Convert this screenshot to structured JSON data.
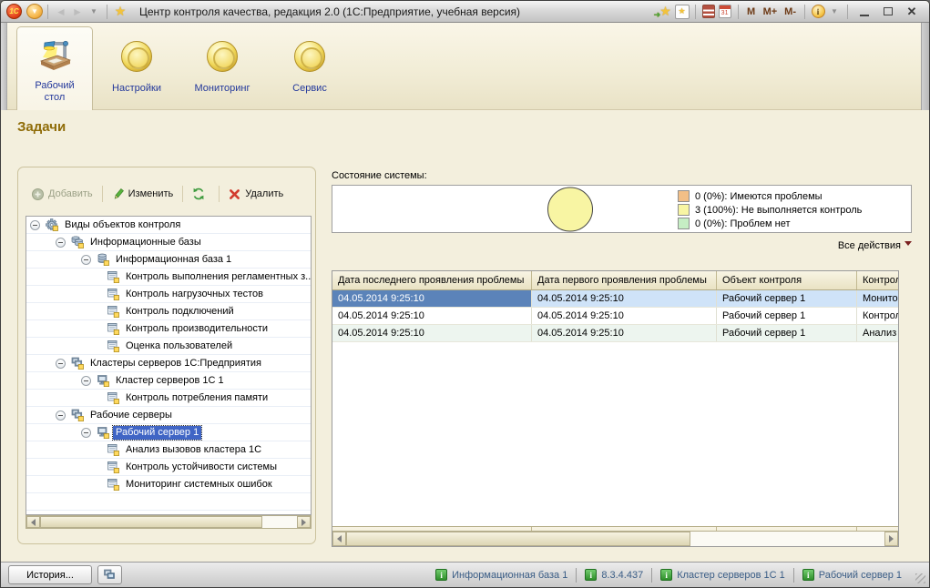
{
  "titlebar": {
    "title": "Центр контроля качества, редакция 2.0 (1С:Предприятие, учебная версия)",
    "logo_text": "1С",
    "calendar_day": "31",
    "memory_buttons": [
      "M",
      "M+",
      "M-"
    ]
  },
  "tabs": {
    "desktop": {
      "label_line1": "Рабочий",
      "label_line2": "стол"
    },
    "settings": {
      "label": "Настройки"
    },
    "monitoring": {
      "label": "Мониторинг"
    },
    "service": {
      "label": "Сервис"
    }
  },
  "page_title": "Задачи",
  "left_panel": {
    "toolbar": {
      "add": "Добавить",
      "edit": "Изменить",
      "delete": "Удалить"
    },
    "tree": [
      {
        "label": "Виды объектов контроля",
        "level": 0,
        "icon": "gear",
        "expanded": true
      },
      {
        "label": "Информационные базы",
        "level": 1,
        "icon": "databases",
        "expanded": true
      },
      {
        "label": "Информационная база 1",
        "level": 2,
        "icon": "database",
        "expanded": true
      },
      {
        "label": "Контроль выполнения регламентных з...",
        "level": 3,
        "icon": "task"
      },
      {
        "label": "Контроль нагрузочных тестов",
        "level": 3,
        "icon": "task"
      },
      {
        "label": "Контроль подключений",
        "level": 3,
        "icon": "task"
      },
      {
        "label": "Контроль производительности",
        "level": 3,
        "icon": "task"
      },
      {
        "label": "Оценка пользователей",
        "level": 3,
        "icon": "task"
      },
      {
        "label": "Кластеры серверов 1С:Предприятия",
        "level": 1,
        "icon": "servers",
        "expanded": true
      },
      {
        "label": "Кластер серверов 1С 1",
        "level": 2,
        "icon": "server",
        "expanded": true
      },
      {
        "label": "Контроль потребления памяти",
        "level": 3,
        "icon": "task"
      },
      {
        "label": "Рабочие серверы",
        "level": 1,
        "icon": "servers",
        "expanded": true
      },
      {
        "label": "Рабочий сервер 1",
        "level": 2,
        "icon": "server",
        "expanded": true,
        "selected": true
      },
      {
        "label": "Анализ вызовов кластера 1С",
        "level": 3,
        "icon": "task"
      },
      {
        "label": "Контроль устойчивости системы",
        "level": 3,
        "icon": "task"
      },
      {
        "label": "Мониторинг системных ошибок",
        "level": 3,
        "icon": "task"
      }
    ]
  },
  "system_state": {
    "label": "Состояние системы:",
    "all_actions_label": "Все действия",
    "chart_data": {
      "type": "pie",
      "slices": [
        {
          "label": "Имеются проблемы",
          "count": 0,
          "percent": 0,
          "color": "#f2bf87"
        },
        {
          "label": "Не выполняется контроль",
          "count": 3,
          "percent": 100,
          "color": "#f8f5a3"
        },
        {
          "label": "Проблем нет",
          "count": 0,
          "percent": 0,
          "color": "#c6eec4"
        }
      ],
      "legend_position": "right"
    },
    "legend": [
      {
        "text": "0 (0%): Имеются проблемы",
        "color": "#f2bf87"
      },
      {
        "text": "3 (100%): Не выполняется контроль",
        "color": "#f8f5a3"
      },
      {
        "text": "0 (0%): Проблем нет",
        "color": "#c6eec4"
      }
    ]
  },
  "problems_table": {
    "columns": [
      "Дата последнего проявления проблемы",
      "Дата первого проявления проблемы",
      "Объект контроля",
      "Контрольн"
    ],
    "rows": [
      {
        "last_date": "04.05.2014 9:25:10",
        "first_date": "04.05.2014 9:25:10",
        "object": "Рабочий сервер 1",
        "control": "Мониторин"
      },
      {
        "last_date": "04.05.2014 9:25:10",
        "first_date": "04.05.2014 9:25:10",
        "object": "Рабочий сервер 1",
        "control": "Контроль у"
      },
      {
        "last_date": "04.05.2014 9:25:10",
        "first_date": "04.05.2014 9:25:10",
        "object": "Рабочий сервер 1",
        "control": "Анализ вы"
      }
    ],
    "selected_row_index": 0
  },
  "status_bar": {
    "history_label": "История...",
    "items": [
      {
        "label": "Информационная база 1"
      },
      {
        "label": "8.3.4.437"
      },
      {
        "label": "Кластер серверов 1С 1"
      },
      {
        "label": "Рабочий сервер 1"
      }
    ]
  }
}
